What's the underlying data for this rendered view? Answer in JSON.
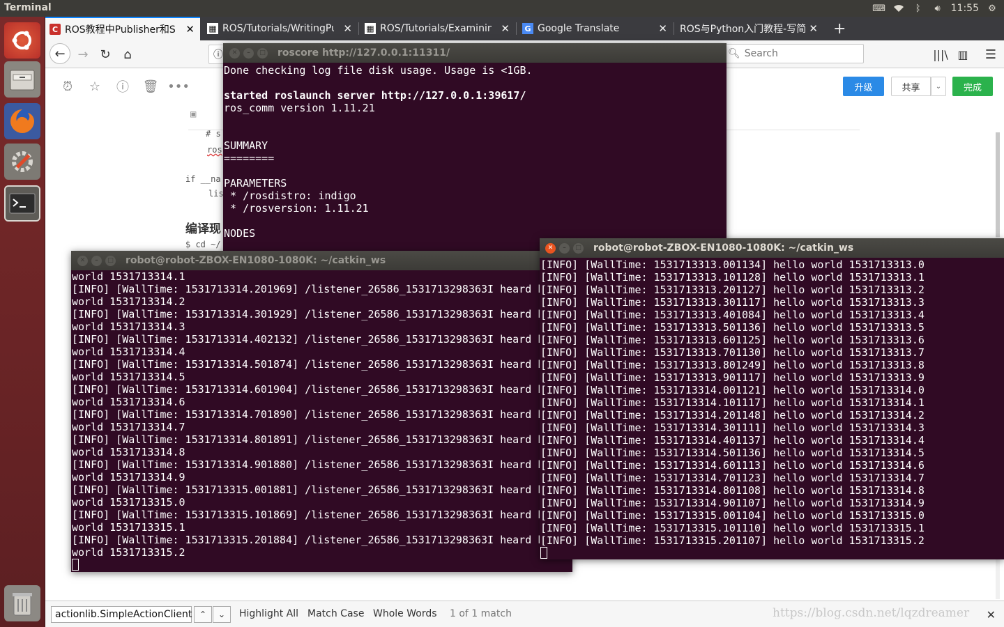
{
  "panel": {
    "title": "Terminal",
    "time": "11:55"
  },
  "browser": {
    "tabs": [
      {
        "label": "ROS教程中Publisher和Su",
        "active": true,
        "favicon": "csdn-c-icon"
      },
      {
        "label": "ROS/Tutorials/WritingPu",
        "active": false,
        "favicon": "ros-grid-icon"
      },
      {
        "label": "ROS/Tutorials/Examining",
        "active": false,
        "favicon": "ros-grid-icon"
      },
      {
        "label": "Google Translate",
        "active": false,
        "favicon": "google-translate-icon"
      },
      {
        "label": "ROS与Python入门教程-写简",
        "active": false,
        "favicon": "none"
      }
    ],
    "new_tab": "+",
    "search_placeholder": "Search",
    "page": {
      "buttons": {
        "upgrade": "升级",
        "share": "共享",
        "done": "完成"
      },
      "code_lines": [
        "# s",
        "ros",
        "if __na",
        "lis"
      ],
      "heading": "编译现",
      "cmd": "$ cd ~/"
    },
    "findbar": {
      "query": "actionlib.SimpleActionClient",
      "highlight_all": "Highlight All",
      "match_case": "Match Case",
      "whole_words": "Whole Words",
      "status": "1 of 1 match"
    }
  },
  "watermark": "https://blog.csdn.net/lqzdreamer",
  "terminals": {
    "roscore": {
      "title": "roscore http://127.0.0.1:11311/",
      "lines": [
        "Done checking log file disk usage. Usage is <1GB.",
        "",
        "started roslaunch server http://127.0.0.1:39617/",
        "ros_comm version 1.11.21",
        "",
        "",
        "SUMMARY",
        "========",
        "",
        "PARAMETERS",
        " * /rosdistro: indigo",
        " * /rosversion: 1.11.21",
        "",
        "NODES"
      ]
    },
    "listener": {
      "title": "robot@robot-ZBOX-EN1080-1080K: ~/catkin_ws",
      "lines": [
        "world 1531713314.1",
        "[INFO] [WallTime: 1531713314.201969] /listener_26586_1531713298363I heard h",
        "world 1531713314.2",
        "[INFO] [WallTime: 1531713314.301929] /listener_26586_1531713298363I heard h",
        "world 1531713314.3",
        "[INFO] [WallTime: 1531713314.402132] /listener_26586_1531713298363I heard h",
        "world 1531713314.4",
        "[INFO] [WallTime: 1531713314.501874] /listener_26586_1531713298363I heard h",
        "world 1531713314.5",
        "[INFO] [WallTime: 1531713314.601904] /listener_26586_1531713298363I heard h",
        "world 1531713314.6",
        "[INFO] [WallTime: 1531713314.701890] /listener_26586_1531713298363I heard h",
        "world 1531713314.7",
        "[INFO] [WallTime: 1531713314.801891] /listener_26586_1531713298363I heard h",
        "world 1531713314.8",
        "[INFO] [WallTime: 1531713314.901880] /listener_26586_1531713298363I heard h",
        "world 1531713314.9",
        "[INFO] [WallTime: 1531713315.001881] /listener_26586_1531713298363I heard h",
        "world 1531713315.0",
        "[INFO] [WallTime: 1531713315.101869] /listener_26586_1531713298363I heard h",
        "world 1531713315.1",
        "[INFO] [WallTime: 1531713315.201884] /listener_26586_1531713298363I heard h",
        "world 1531713315.2"
      ]
    },
    "talker": {
      "title": "robot@robot-ZBOX-EN1080-1080K: ~/catkin_ws",
      "lines": [
        "[INFO] [WallTime: 1531713313.001134] hello world 1531713313.0",
        "[INFO] [WallTime: 1531713313.101128] hello world 1531713313.1",
        "[INFO] [WallTime: 1531713313.201127] hello world 1531713313.2",
        "[INFO] [WallTime: 1531713313.301117] hello world 1531713313.3",
        "[INFO] [WallTime: 1531713313.401084] hello world 1531713313.4",
        "[INFO] [WallTime: 1531713313.501136] hello world 1531713313.5",
        "[INFO] [WallTime: 1531713313.601125] hello world 1531713313.6",
        "[INFO] [WallTime: 1531713313.701130] hello world 1531713313.7",
        "[INFO] [WallTime: 1531713313.801249] hello world 1531713313.8",
        "[INFO] [WallTime: 1531713313.901117] hello world 1531713313.9",
        "[INFO] [WallTime: 1531713314.001121] hello world 1531713314.0",
        "[INFO] [WallTime: 1531713314.101117] hello world 1531713314.1",
        "[INFO] [WallTime: 1531713314.201148] hello world 1531713314.2",
        "[INFO] [WallTime: 1531713314.301111] hello world 1531713314.3",
        "[INFO] [WallTime: 1531713314.401137] hello world 1531713314.4",
        "[INFO] [WallTime: 1531713314.501136] hello world 1531713314.5",
        "[INFO] [WallTime: 1531713314.601113] hello world 1531713314.6",
        "[INFO] [WallTime: 1531713314.701123] hello world 1531713314.7",
        "[INFO] [WallTime: 1531713314.801108] hello world 1531713314.8",
        "[INFO] [WallTime: 1531713314.901107] hello world 1531713314.9",
        "[INFO] [WallTime: 1531713315.001104] hello world 1531713315.0",
        "[INFO] [WallTime: 1531713315.101110] hello world 1531713315.1",
        "[INFO] [WallTime: 1531713315.201107] hello world 1531713315.2"
      ]
    }
  }
}
